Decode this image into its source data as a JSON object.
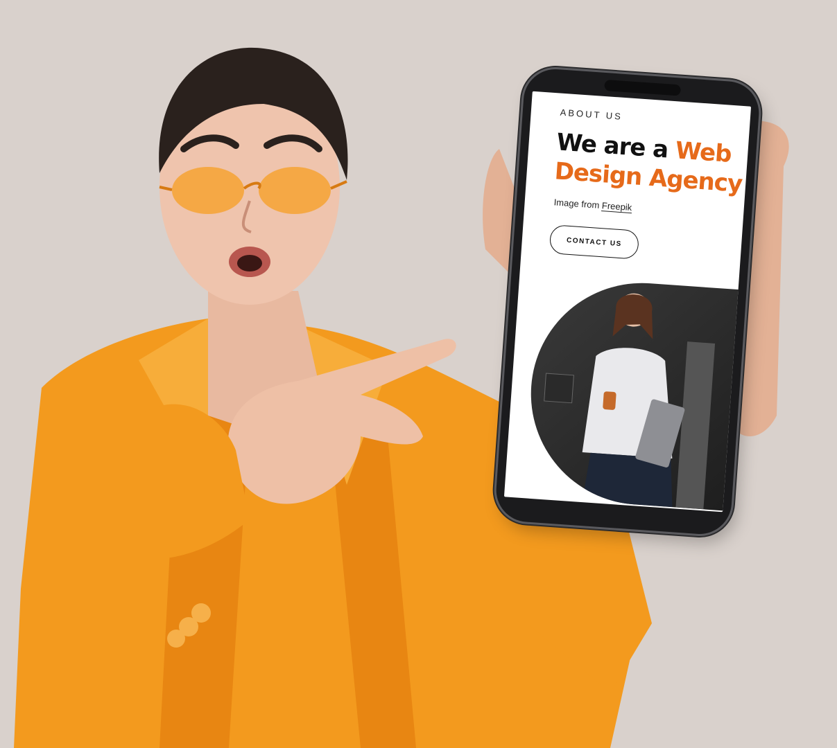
{
  "phone_screen": {
    "eyebrow": "ABOUT US",
    "headline_lead": "We are a",
    "headline_accent": "Web Design Agency",
    "credit_prefix": "Image from",
    "credit_link": "Freepik",
    "cta_label": "CONTACT US",
    "accent_color": "#e66a1a"
  },
  "photo": {
    "background_color": "#d9d1cc",
    "jacket_color": "#f39a1e",
    "glasses_color": "#f5a53a"
  }
}
